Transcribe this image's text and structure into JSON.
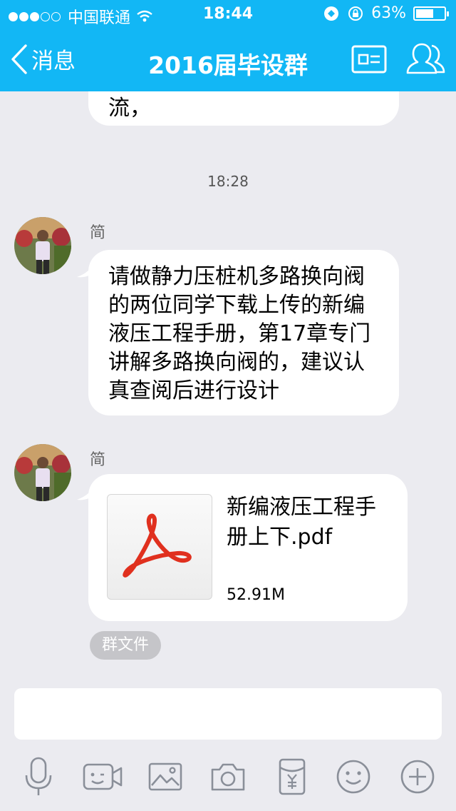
{
  "status_bar": {
    "carrier": "中国联通",
    "time": "18:44",
    "battery_percent": "63%",
    "battery_level": 0.63,
    "signal_bars_filled": 3,
    "signal_bars_total": 5
  },
  "nav": {
    "back_label": "消息",
    "title": "2016届毕设群",
    "icons": [
      "back-chevron-icon",
      "group-card-icon",
      "group-members-icon"
    ]
  },
  "chat": {
    "previous_message_tail": "流，",
    "timestamp": "18:28",
    "messages": [
      {
        "sender": "简",
        "type": "text",
        "text": "请做静力压桩机多路换向阀的两位同学下载上传的新编液压工程手册，第17章专门讲解多路换向阀的，建议认真查阅后进行设计"
      },
      {
        "sender": "简",
        "type": "file",
        "file_name": "新编液压工程手册上下.pdf",
        "file_size": "52.91M",
        "file_icon": "pdf-icon",
        "tag": "群文件"
      }
    ]
  },
  "composer": {
    "placeholder": "",
    "tools": [
      "microphone-icon",
      "video-call-icon",
      "image-icon",
      "camera-icon",
      "red-packet-icon",
      "emoji-icon",
      "plus-icon"
    ]
  },
  "colors": {
    "header": "#12b7f5",
    "background": "#ebebf0",
    "bubble": "#ffffff",
    "tag": "#c5c5c9",
    "pdf_red": "#e0301e",
    "toolbar_icon": "#8a8f99"
  }
}
